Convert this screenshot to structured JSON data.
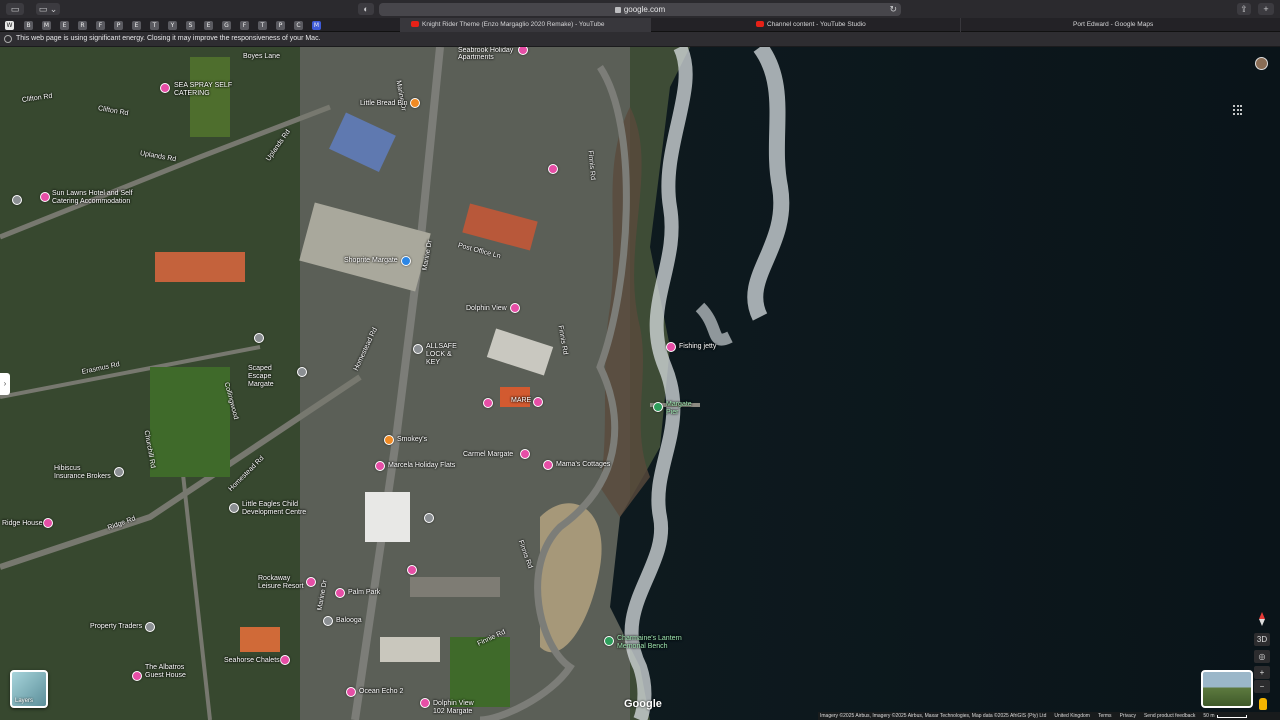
{
  "browser": {
    "address": "google.com",
    "tab_favicons": [
      "W",
      "B",
      "M",
      "E",
      "R",
      "F",
      "P",
      "E",
      "T",
      "Y",
      "S",
      "E",
      "G",
      "F",
      "T",
      "P",
      "C",
      "M"
    ],
    "tabs": [
      {
        "label": "Knight Rider Theme (Enzo Margaglio 2020 Remake) - YouTube",
        "icon": "youtube-icon"
      },
      {
        "label": "Channel content - YouTube Studio",
        "icon": "youtube-icon"
      },
      {
        "label": "Port Edward - Google Maps",
        "icon": "maps-icon"
      }
    ],
    "notice": "This web page is using significant energy. Closing it may improve the responsiveness of your Mac."
  },
  "map": {
    "places": [
      {
        "name": "SEA SPRAY SELF CATERING",
        "color": "pink"
      },
      {
        "name": "Little Bread Bin",
        "color": "orange"
      },
      {
        "name": "Seabrook Holiday Apartments",
        "color": "pink"
      },
      {
        "name": "Sun Lawns Hotel and Self Catering Accommodation",
        "color": "pink"
      },
      {
        "name": "Shoprite Margate",
        "color": "blue"
      },
      {
        "name": "Dolphin View",
        "color": "pink"
      },
      {
        "name": "ALLSAFE LOCK & KEY",
        "color": "grey"
      },
      {
        "name": "Scaped Escape Margate",
        "color": "grey"
      },
      {
        "name": "Fishing jetty",
        "color": "pink"
      },
      {
        "name": "MARE",
        "color": "pink"
      },
      {
        "name": "Margate Pier",
        "color": "green"
      },
      {
        "name": "Smokey's",
        "color": "orange"
      },
      {
        "name": "Marcela Holiday Flats",
        "color": "pink"
      },
      {
        "name": "Carmel Margate",
        "color": "pink"
      },
      {
        "name": "Mama's Cottages",
        "color": "pink"
      },
      {
        "name": "Hibiscus Insurance Brokers",
        "color": "grey"
      },
      {
        "name": "Little Eagles Child Development Centre",
        "color": "grey"
      },
      {
        "name": "Ridge House",
        "color": "pink"
      },
      {
        "name": "Rockaway Leisure Resort",
        "color": "pink"
      },
      {
        "name": "Palm Park",
        "color": "pink"
      },
      {
        "name": "Balooga",
        "color": "grey"
      },
      {
        "name": "Property Traders",
        "color": "grey"
      },
      {
        "name": "Seahorse Chalets",
        "color": "pink"
      },
      {
        "name": "The Albatros Guest House",
        "color": "pink"
      },
      {
        "name": "Charmaine's Lantern Memorial Bench",
        "color": "green"
      },
      {
        "name": "Ocean Echo 2",
        "color": "pink"
      },
      {
        "name": "Dolphin View 102 Margate",
        "color": "pink"
      }
    ],
    "roads": [
      "Boyes Lane",
      "Clifton Rd",
      "Clifton Rd",
      "Uplands Rd",
      "Uplands Rd",
      "Marine Dr",
      "Marine Dr",
      "Marine Dr",
      "Post Office Ln",
      "Homestead Rd",
      "Homestead Rd",
      "Erasmus Rd",
      "Collingwood",
      "Churchill Rd",
      "Ridge Rd",
      "Finnis Rd",
      "Finnis Rd",
      "Finnis Rd",
      "Finnie Rd"
    ],
    "layers_label": "Layers",
    "google_logo": "Google",
    "controls": {
      "view3d": "3D",
      "zoom_in": "+",
      "zoom_out": "−"
    },
    "attribution": [
      "Imagery ©2025 Airbus, Imagery ©2025 Airbus, Maxar Technologies, Map data ©2025 AfriGIS (Pty) Ltd",
      "United Kingdom",
      "Terms",
      "Privacy",
      "Send product feedback"
    ],
    "scale_label": "50 m",
    "colors": {
      "pink": "#e64ea6",
      "grey": "#8b8f93",
      "orange": "#f08a24",
      "blue": "#2b86e6",
      "green": "#2e9e5c"
    }
  }
}
